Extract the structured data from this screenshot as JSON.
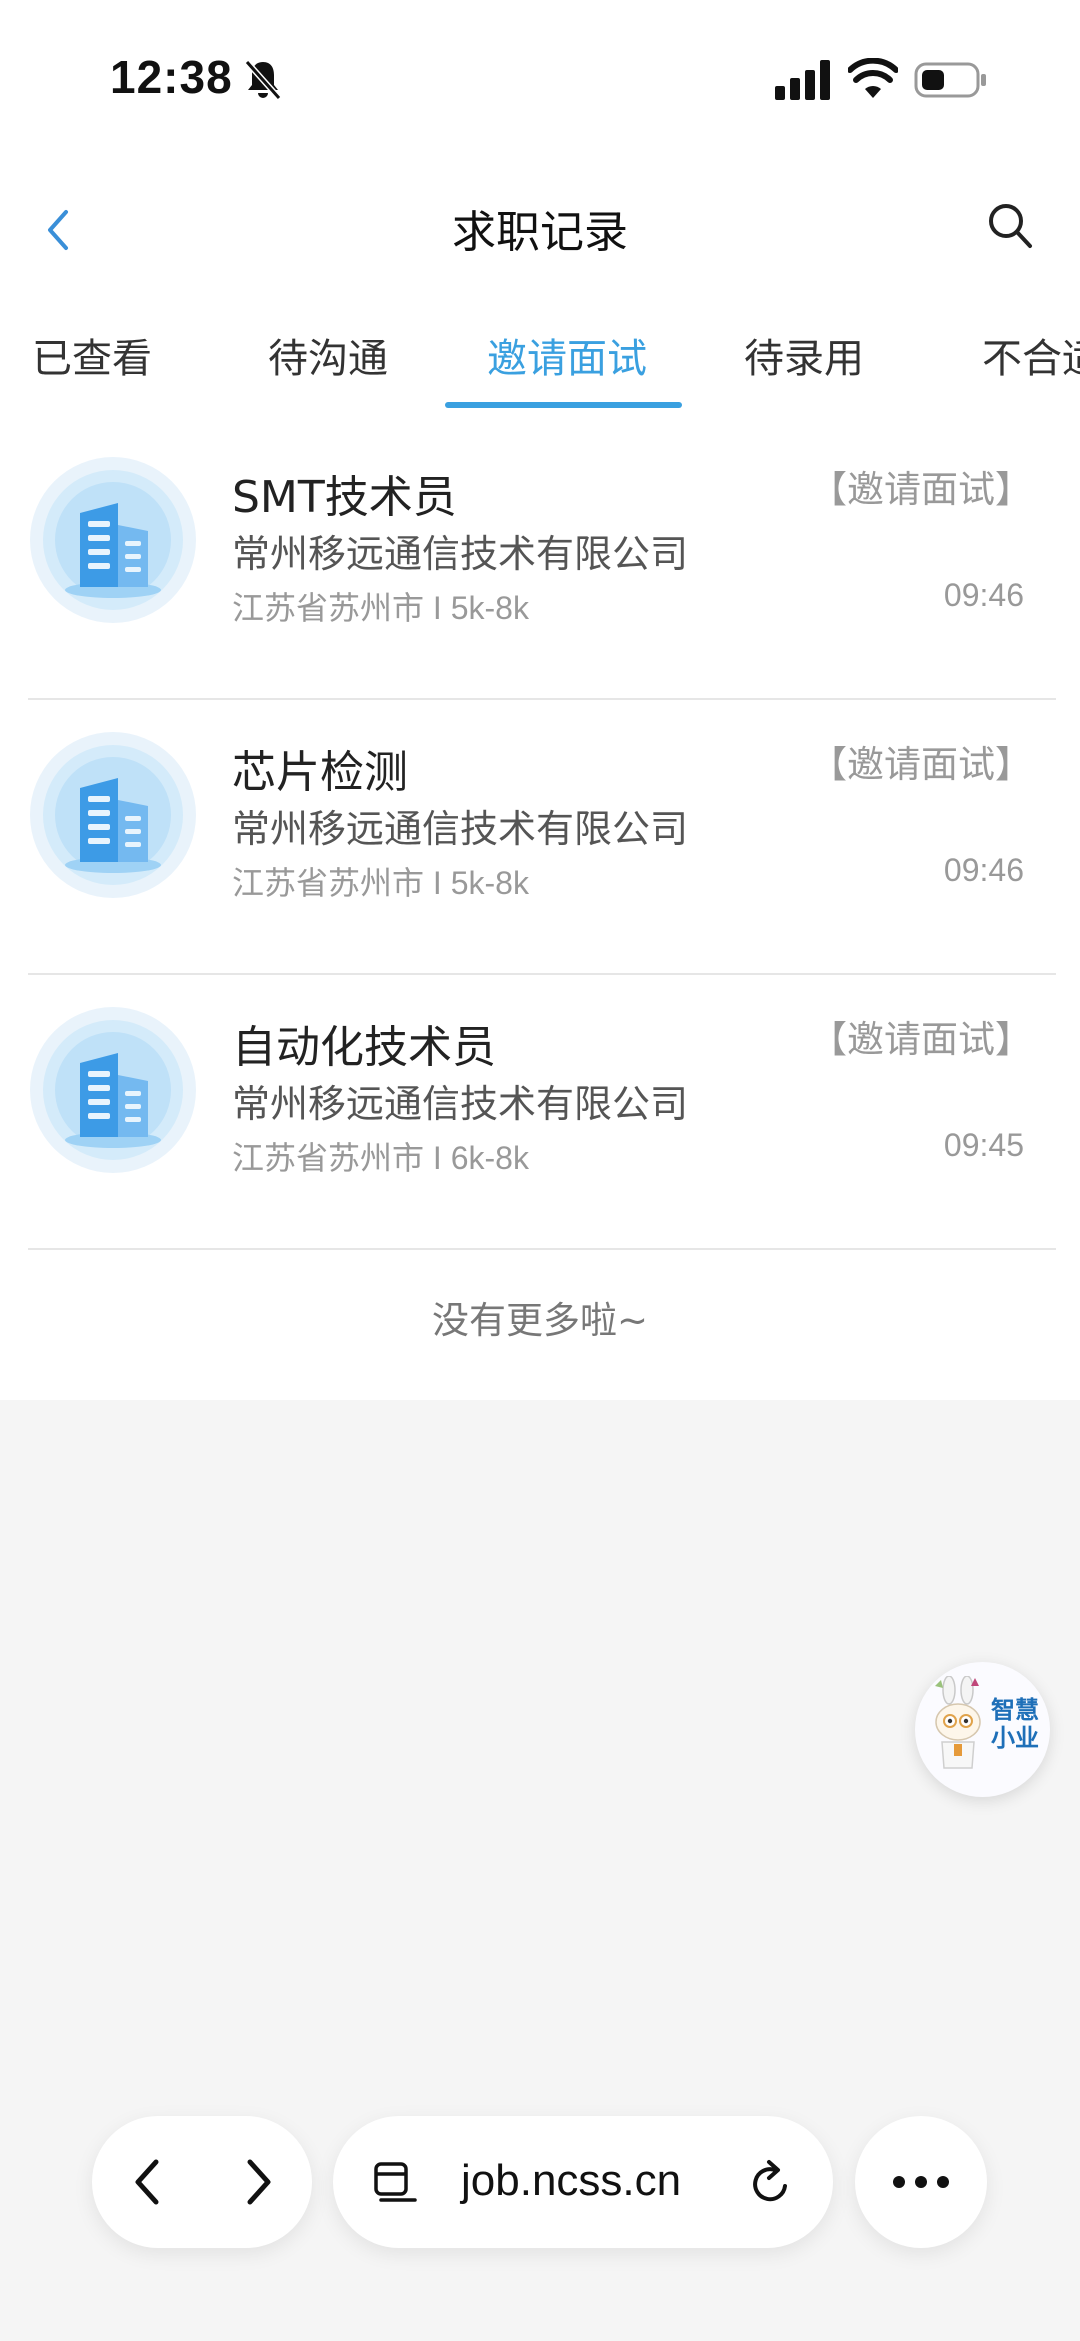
{
  "status_bar": {
    "time": "12:38",
    "icons": [
      "bell-slash-icon",
      "signal-icon",
      "wifi-icon",
      "battery-icon"
    ]
  },
  "header": {
    "title": "求职记录",
    "back_icon": "chevron-left-icon",
    "search_icon": "search-icon"
  },
  "tabs": [
    {
      "label": "已查看",
      "active": false
    },
    {
      "label": "待沟通",
      "active": false
    },
    {
      "label": "邀请面试",
      "active": true
    },
    {
      "label": "待录用",
      "active": false
    },
    {
      "label": "不合适",
      "active": false
    }
  ],
  "accent_color": "#3aa0e0",
  "records": [
    {
      "title": "SMT技术员",
      "status": "【邀请面试】",
      "company": "常州移远通信技术有限公司",
      "location": "江苏省苏州市",
      "separator": "I",
      "salary": "5k-8k",
      "time": "09:46"
    },
    {
      "title": "芯片检测",
      "status": "【邀请面试】",
      "company": "常州移远通信技术有限公司",
      "location": "江苏省苏州市",
      "separator": "I",
      "salary": "5k-8k",
      "time": "09:46"
    },
    {
      "title": "自动化技术员",
      "status": "【邀请面试】",
      "company": "常州移远通信技术有限公司",
      "location": "江苏省苏州市",
      "separator": "I",
      "salary": "6k-8k",
      "time": "09:45"
    }
  ],
  "list_footer": "没有更多啦~",
  "assistant": {
    "line1": "智慧",
    "line2": "小业"
  },
  "browser": {
    "url": "job.ncss.cn",
    "icons": [
      "chevron-left-icon",
      "chevron-right-icon",
      "reader-icon",
      "reload-icon",
      "more-icon"
    ]
  }
}
